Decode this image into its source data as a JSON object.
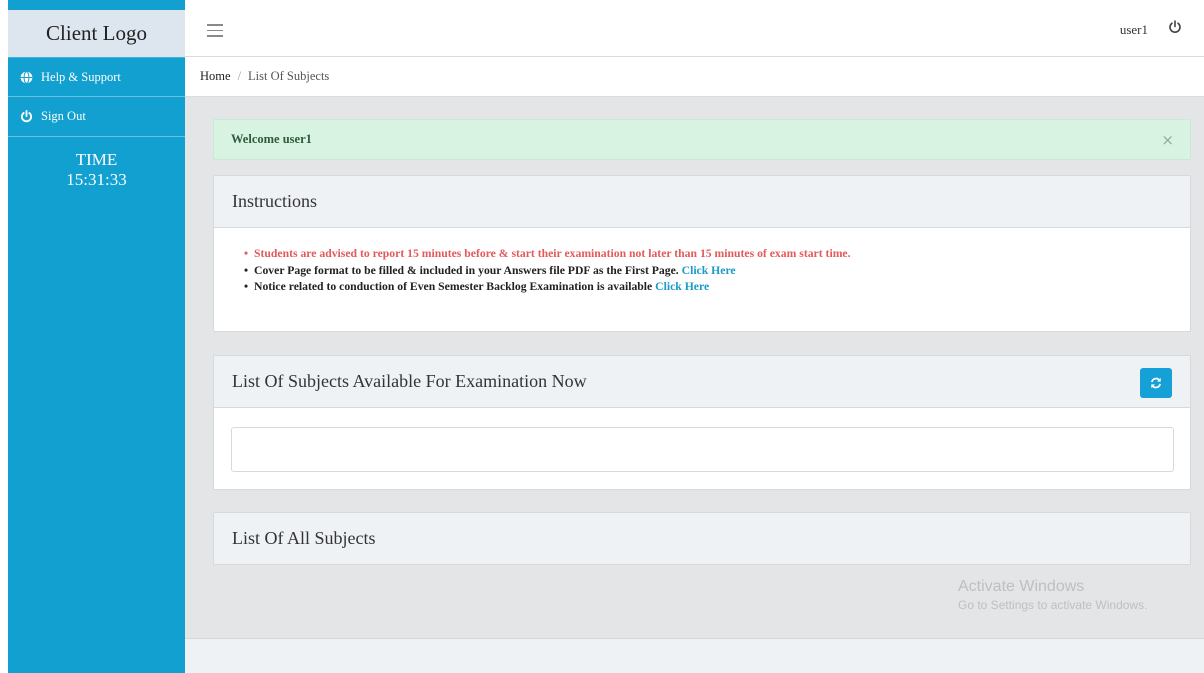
{
  "sidebar": {
    "logo": "Client Logo",
    "items": [
      {
        "label": "Help & Support",
        "icon": "globe-icon"
      },
      {
        "label": "Sign Out",
        "icon": "power-icon"
      }
    ],
    "time_label": "TIME",
    "time_value": "15:31:33"
  },
  "header": {
    "user": "user1",
    "menu_icon": "hamburger-icon",
    "logout_icon": "power-icon"
  },
  "breadcrumb": {
    "home": "Home",
    "separator": "/",
    "current": "List Of Subjects"
  },
  "alert": {
    "message": "Welcome user1",
    "close": "×"
  },
  "instructions": {
    "title": "Instructions",
    "items": [
      {
        "text": "Students are advised to report 15 minutes before & start their examination not later than 15 minutes of exam start time.",
        "link": ""
      },
      {
        "text": "Cover Page format to be filled & included in your Answers file PDF as the First Page. ",
        "link": "Click Here"
      },
      {
        "text": "Notice related to conduction of Even Semester Backlog Examination is available ",
        "link": "Click Here"
      }
    ]
  },
  "available_subjects": {
    "title": "List Of Subjects Available For Examination Now",
    "refresh_icon": "refresh-icon"
  },
  "all_subjects": {
    "title": "List Of All Subjects"
  },
  "watermark": {
    "title": "Activate Windows",
    "subtitle": "Go to Settings to activate Windows."
  },
  "colors": {
    "sidebar": "#11a0cf",
    "alert_bg": "#d8f3e1",
    "link": "#1a9bc8",
    "warning_text": "#e25a5a"
  }
}
